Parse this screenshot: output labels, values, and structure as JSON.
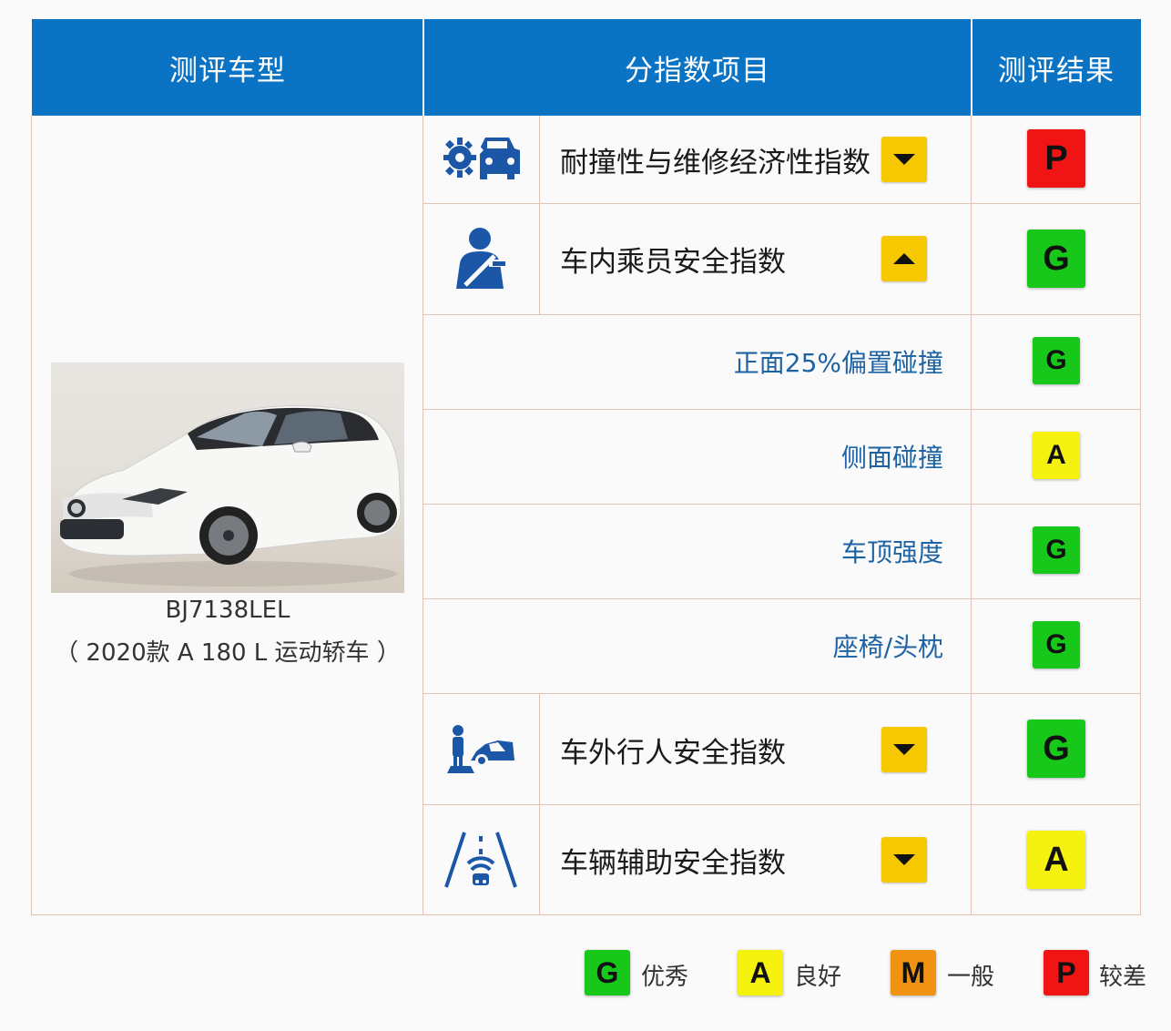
{
  "header": {
    "col_model": "测评车型",
    "col_items": "分指数项目",
    "col_result": "测评结果"
  },
  "vehicle": {
    "code": "BJ7138LEL",
    "desc": "（ 2020款 A 180 L 运动轿车 ）"
  },
  "rows": [
    {
      "label": "耐撞性与维修经济性指数",
      "icon": "crash-repair-icon",
      "arrow": "down",
      "grade": "P"
    },
    {
      "label": "车内乘员安全指数",
      "icon": "occupant-seatbelt-icon",
      "arrow": "up",
      "grade": "G"
    },
    {
      "label": "正面25%偏置碰撞",
      "grade": "G"
    },
    {
      "label": "侧面碰撞",
      "grade": "A"
    },
    {
      "label": "车顶强度",
      "grade": "G"
    },
    {
      "label": "座椅/头枕",
      "grade": "G"
    },
    {
      "label": "车外行人安全指数",
      "icon": "pedestrian-car-icon",
      "arrow": "down",
      "grade": "G"
    },
    {
      "label": "车辆辅助安全指数",
      "icon": "driver-assist-icon",
      "arrow": "down",
      "grade": "A"
    }
  ],
  "legend": [
    {
      "grade": "G",
      "label": "优秀"
    },
    {
      "grade": "A",
      "label": "良好"
    },
    {
      "grade": "M",
      "label": "一般"
    },
    {
      "grade": "P",
      "label": "较差"
    }
  ],
  "colors": {
    "header_blue": "#0b73c3",
    "icon_blue": "#1b57a6",
    "grade_G": "#17c81b",
    "grade_A": "#f4f20e",
    "grade_M": "#f19312",
    "grade_P": "#f01414",
    "arrow_box": "#f6c800",
    "sub_label": "#1d62a3"
  }
}
